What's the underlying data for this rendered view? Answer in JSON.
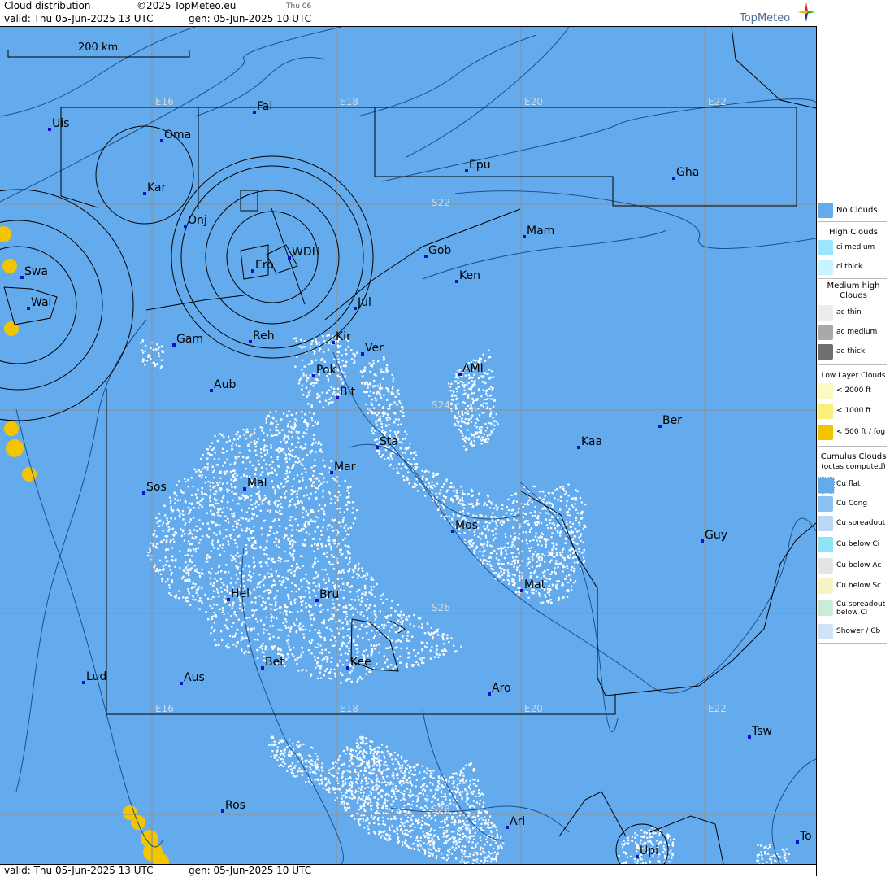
{
  "header": {
    "title": "Cloud distribution",
    "copyright": "©2025 TopMeteo.eu",
    "day_tab": "Thu 06",
    "valid": "valid:  Thu  05-Jun-2025  13 UTC",
    "gen": "gen: 05-Jun-2025 10 UTC",
    "logo": "TopMeteo"
  },
  "footer": {
    "valid": "valid:  Thu  05-Jun-2025  13 UTC",
    "gen": "gen: 05-Jun-2025 10 UTC"
  },
  "map": {
    "scale_label": "200 km",
    "colors": {
      "background": "#64abee",
      "clouds": "#ffffff",
      "fog": "#f2c500",
      "stations": "#1010c8"
    },
    "grid_labels": [
      "E16",
      "E18",
      "E20",
      "E22",
      "S22",
      "S24",
      "S26",
      "S28",
      "E16",
      "E18",
      "E20",
      "E22"
    ],
    "places": [
      "Uis",
      "Fal",
      "Oma",
      "Kar",
      "Epu",
      "Gha",
      "Onj",
      "Mam",
      "Gob",
      "WDH",
      "Swa",
      "Ero",
      "Ken",
      "Wal",
      "Jul",
      "Gam",
      "Reh",
      "Kir",
      "Ver",
      "AMI",
      "Pok",
      "Aub",
      "Bit",
      "Ber",
      "Sta",
      "Kaa",
      "Mar",
      "Sos",
      "Mal",
      "Mos",
      "Guy",
      "Mat",
      "Hel",
      "Bru",
      "Bet",
      "Kee",
      "Lud",
      "Aus",
      "Aro",
      "Tsw",
      "Ros",
      "Ari",
      "To",
      "Upi"
    ]
  },
  "legend": {
    "no_clouds": "No Clouds",
    "high_title": "High Clouds",
    "high": [
      "ci medium",
      "ci thick"
    ],
    "medium_title": "Medium high Clouds",
    "medium": [
      "ac thin",
      "ac medium",
      "ac thick"
    ],
    "low_title": "Low Layer Clouds",
    "low": [
      "< 2000 ft",
      "< 1000 ft",
      "< 500 ft / fog"
    ],
    "cumulus_title": "Cumulus Clouds",
    "cumulus_sub": "(octas computed)",
    "cumulus": [
      "Cu flat",
      "Cu Cong",
      "Cu spreadout",
      "Cu below Ci",
      "Cu below Ac",
      "Cu below Sc",
      "Cu spreadout below Ci",
      "Shower / Cb"
    ]
  }
}
